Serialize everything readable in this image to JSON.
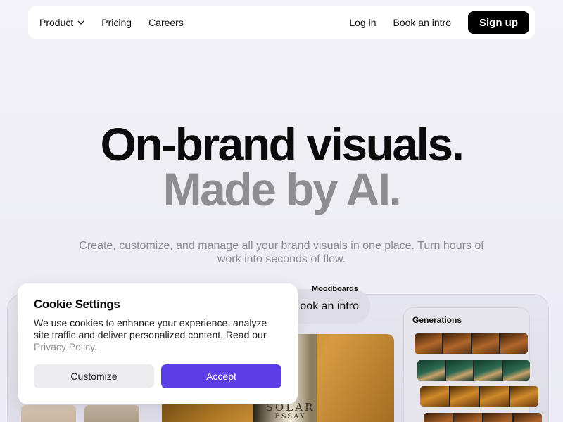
{
  "nav": {
    "product": "Product",
    "pricing": "Pricing",
    "careers": "Careers",
    "login": "Log in",
    "book_intro": "Book an intro",
    "signup": "Sign up"
  },
  "hero": {
    "title_line1": "On-brand visuals.",
    "title_line2": "Made by AI.",
    "subtitle": "Create, customize, and manage all your brand visuals in one place. Turn hours of work into seconds of flow."
  },
  "preview": {
    "moodboards": "Moodboards",
    "book_intro": "ook an intro",
    "generations": "Generations",
    "product_label": "SOLAR",
    "product_sublabel": "ESSAY"
  },
  "cookie": {
    "title": "Cookie Settings",
    "text": "We use cookies to enhance your experience, analyze site traffic and deliver personalized content. Read our ",
    "privacy_link": "Privacy Policy",
    "period": ".",
    "customize": "Customize",
    "accept": "Accept"
  },
  "colors": {
    "accent": "#5b3ee6",
    "title_dark": "#0b0b0b",
    "title_gray": "#8e8d92"
  }
}
